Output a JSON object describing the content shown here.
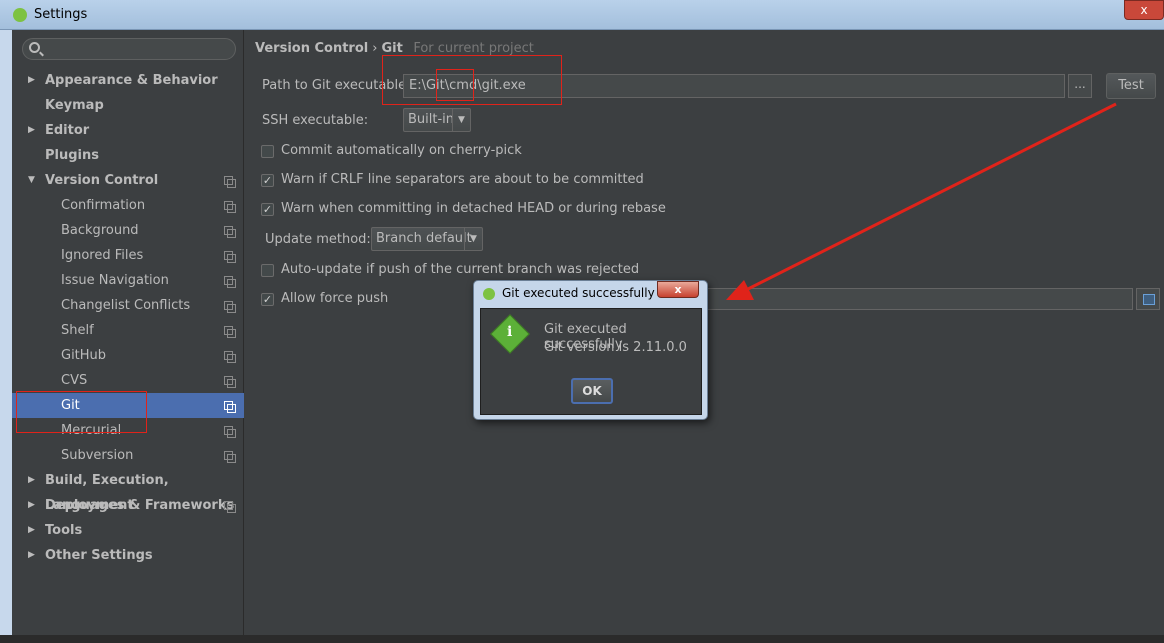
{
  "window": {
    "title": "Settings",
    "close_label": "x"
  },
  "search": {
    "placeholder": ""
  },
  "sidebar": {
    "items": [
      {
        "label": "Appearance & Behavior"
      },
      {
        "label": "Keymap"
      },
      {
        "label": "Editor"
      },
      {
        "label": "Plugins"
      },
      {
        "label": "Version Control"
      },
      {
        "label": "Confirmation"
      },
      {
        "label": "Background"
      },
      {
        "label": "Ignored Files"
      },
      {
        "label": "Issue Navigation"
      },
      {
        "label": "Changelist Conflicts"
      },
      {
        "label": "Shelf"
      },
      {
        "label": "GitHub"
      },
      {
        "label": "CVS"
      },
      {
        "label": "Git"
      },
      {
        "label": "Mercurial"
      },
      {
        "label": "Subversion"
      },
      {
        "label": "Build, Execution, Deployment"
      },
      {
        "label": "Languages & Frameworks"
      },
      {
        "label": "Tools"
      },
      {
        "label": "Other Settings"
      }
    ],
    "selected": "Git"
  },
  "breadcrumb": {
    "part1": "Version Control",
    "separator": "›",
    "part2": "Git",
    "note": "For current project"
  },
  "git": {
    "path_label": "Path to Git executable:",
    "path_value": "E:\\Git\\cmd\\git.exe",
    "browse_label": "...",
    "test_label": "Test",
    "ssh_label": "SSH executable:",
    "ssh_value": "Built-in",
    "commit_cherry": "Commit automatically on cherry-pick",
    "warn_crlf": "Warn if CRLF line separators are about to be committed",
    "warn_detached": "Warn when committing in detached HEAD or during rebase",
    "update_label": "Update method:",
    "update_value": "Branch default",
    "auto_update": "Auto-update if push of the current branch was rejected",
    "force_push": "Allow force push",
    "checks": {
      "commit_cherry": false,
      "warn_crlf": true,
      "warn_detached": true,
      "auto_update": false,
      "force_push": true
    }
  },
  "dialog": {
    "title": "Git executed successfully",
    "close_label": "x",
    "message_line1": "Git executed successfully",
    "message_line2": "Git version is 2.11.0.0",
    "ok_label": "OK"
  },
  "colors": {
    "accent": "#4b6eaf",
    "annotation": "#e0231a",
    "background": "#3c3f41"
  }
}
